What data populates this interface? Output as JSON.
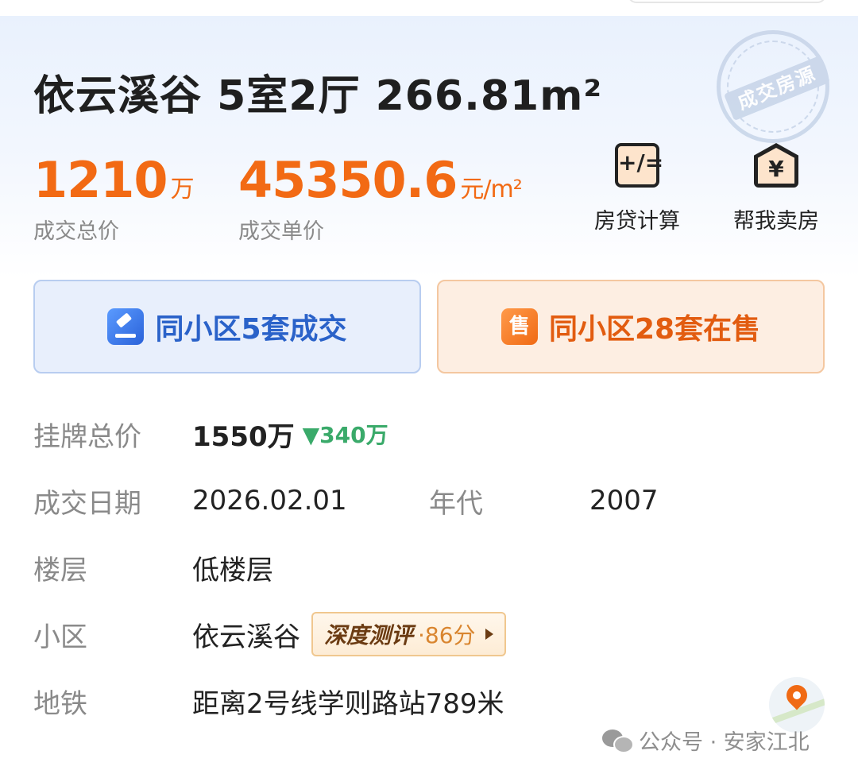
{
  "title": "依云溪谷 5室2厅 266.81m²",
  "stamp_text": "成交房源",
  "deal_price": {
    "value": "1210",
    "unit": "万",
    "label": "成交总价"
  },
  "unit_price": {
    "value": "45350.6",
    "unit": "元/m²",
    "label": "成交单价"
  },
  "tools": {
    "mortgage": {
      "label": "房贷计算",
      "icon": "calculator-icon",
      "glyph": "+/="
    },
    "sell": {
      "label": "帮我卖房",
      "icon": "house-yen-icon",
      "glyph": "¥"
    }
  },
  "buttons": {
    "sold": {
      "label": "同小区5套成交",
      "icon": "gavel-icon"
    },
    "on_sale": {
      "label": "同小区28套在售",
      "icon": "sale-tag-icon",
      "glyph": "售"
    }
  },
  "details": {
    "listing_price": {
      "label": "挂牌总价",
      "value": "1550万",
      "drop": "▼340万"
    },
    "deal_date": {
      "label": "成交日期",
      "value": "2026.02.01"
    },
    "year_built": {
      "label": "年代",
      "value": "2007"
    },
    "floor": {
      "label": "楼层",
      "value": "低楼层"
    },
    "community": {
      "label": "小区",
      "value": "依云溪谷",
      "eval_title": "深度测评",
      "eval_score": "·86分"
    },
    "metro": {
      "label": "地铁",
      "value": "距离2号线学则路站789米"
    }
  },
  "watermark": "公众号 · 安家江北",
  "colors": {
    "accent_orange": "#f26a14",
    "accent_blue": "#2a62c9",
    "drop_green": "#3aaa6a"
  }
}
